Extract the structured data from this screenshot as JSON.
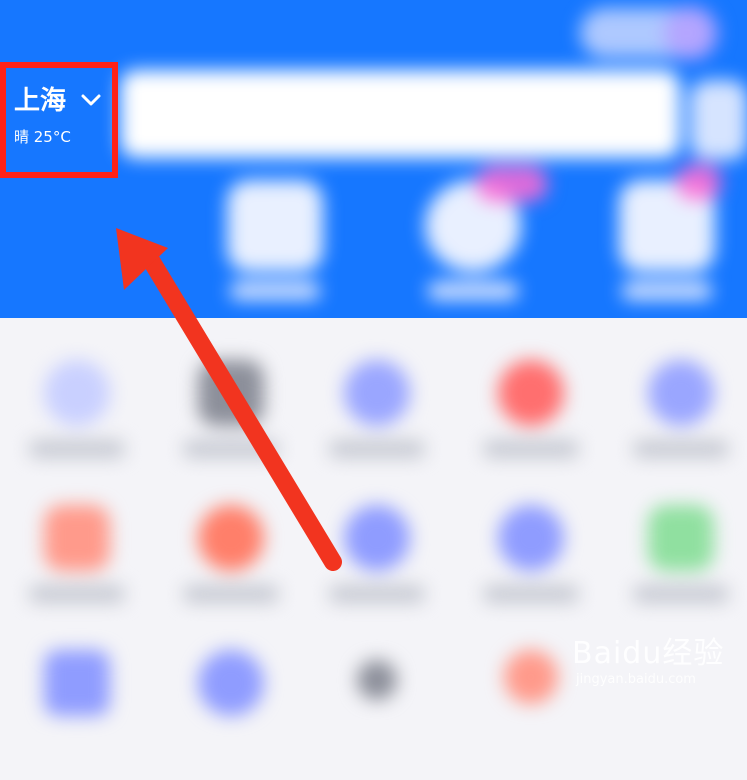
{
  "header": {
    "app_title": "",
    "city": "上海",
    "weather": "晴 25°C",
    "search_placeholder": ""
  },
  "colors": {
    "primary_blue": "#1677ff",
    "highlight_red": "#ff2218",
    "arrow_red": "#f2341f"
  },
  "icons": {
    "city_dropdown": "chevron-down-icon"
  },
  "watermark": {
    "brand": "Baidu经验",
    "url": "jingyan.baidu.com"
  }
}
